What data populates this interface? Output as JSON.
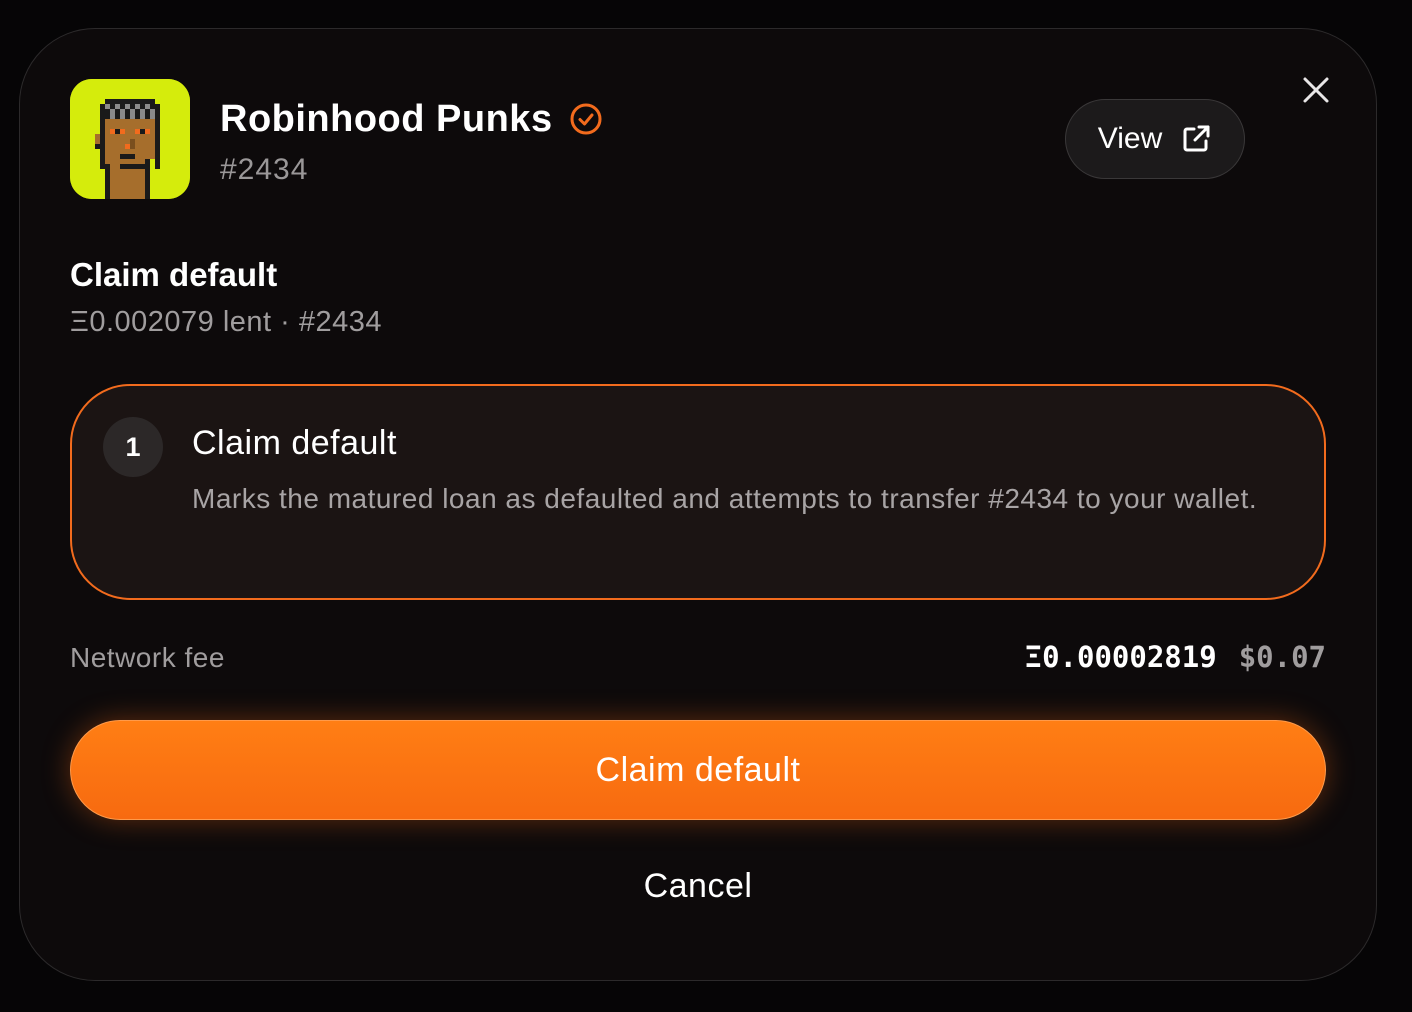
{
  "collection": {
    "name": "Robinhood Punks",
    "token_id": "#2434",
    "verified_icon": "verified-check-icon",
    "avatar_bg": "#d5ec0c"
  },
  "header": {
    "view_label": "View",
    "view_icon": "external-link-icon",
    "close_icon": "close-icon"
  },
  "action": {
    "title": "Claim default",
    "subtitle": "Ξ0.002079 lent · #2434"
  },
  "steps": [
    {
      "number": "1",
      "title": "Claim default",
      "description": "Marks the matured loan as defaulted and attempts to transfer #2434 to your wallet."
    }
  ],
  "fee": {
    "label": "Network fee",
    "eth": "Ξ0.00002819",
    "usd": "$0.07"
  },
  "buttons": {
    "primary": "Claim default",
    "cancel": "Cancel"
  },
  "colors": {
    "accent": "#ff7a14",
    "step_border": "#f26b1d",
    "background": "#0d0a0b"
  }
}
